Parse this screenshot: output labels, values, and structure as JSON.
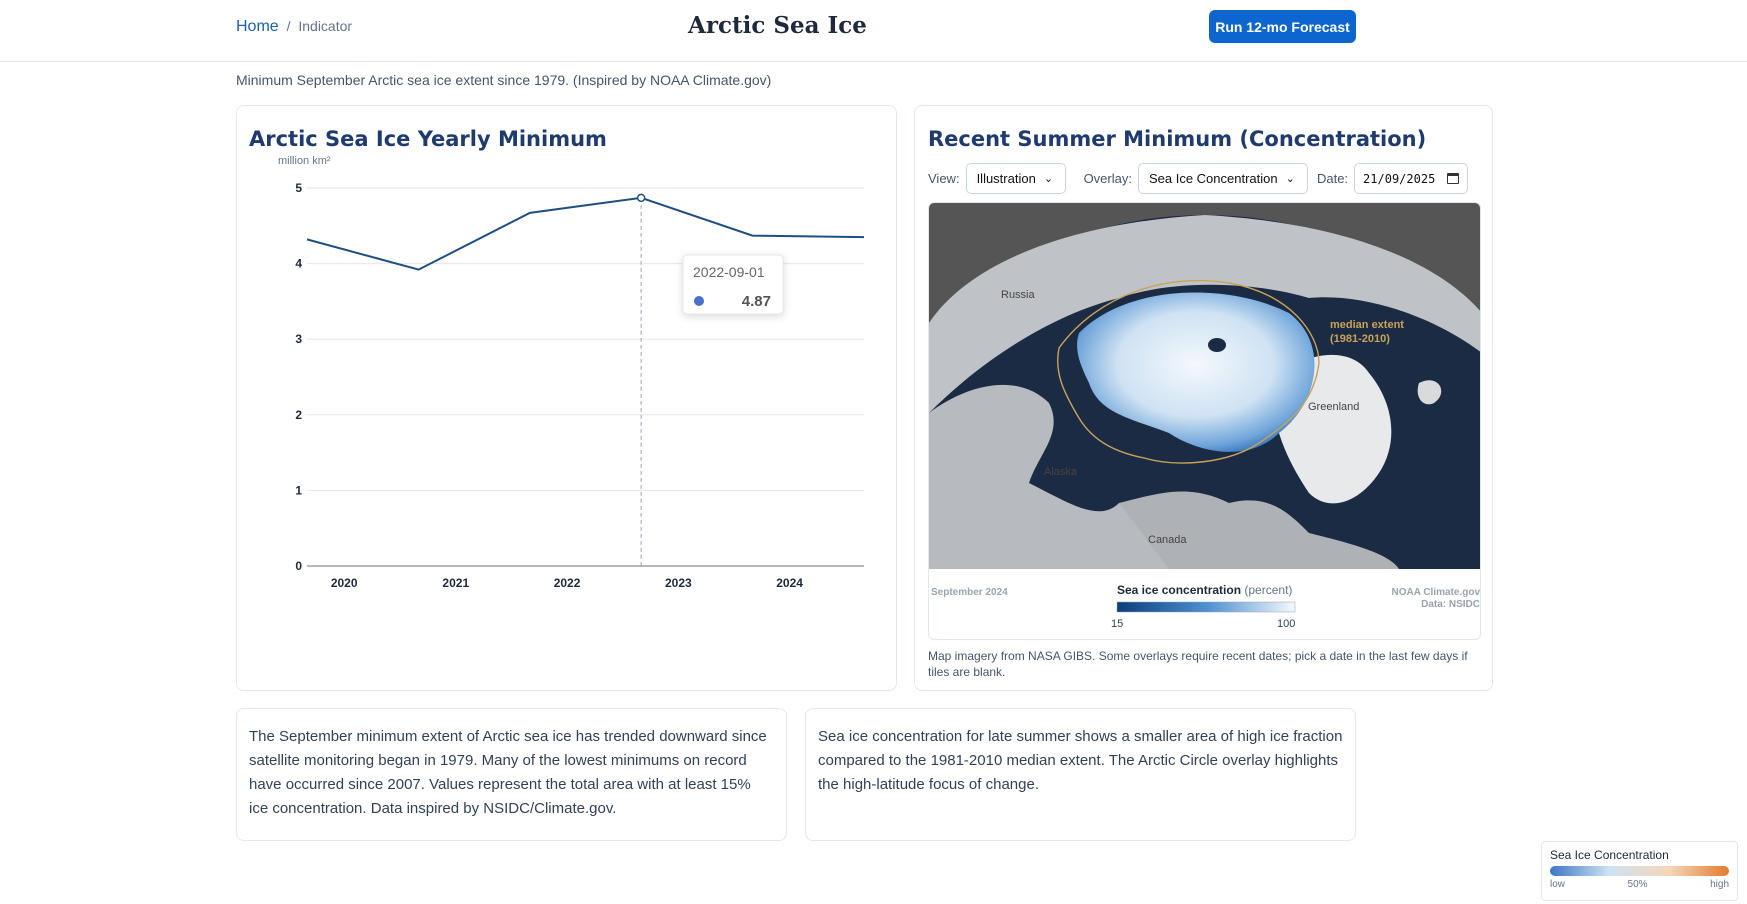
{
  "breadcrumb": {
    "home": "Home",
    "separator": "/",
    "current": "Indicator"
  },
  "header": {
    "title": "Arctic Sea Ice",
    "forecast_button": "Run 12-mo Forecast"
  },
  "subtitle": "Minimum September Arctic sea ice extent since 1979. (Inspired by NOAA Climate.gov)",
  "chart_card": {
    "title": "Arctic Sea Ice Yearly Minimum",
    "tooltip": {
      "date": "2022-09-01",
      "value": "4.87",
      "marker_color": "#4a6fc6"
    }
  },
  "chart_data": {
    "type": "line",
    "title": "Arctic Sea Ice Yearly Minimum",
    "ylabel": "million km²",
    "xlabel": "",
    "x": [
      "2019-09-01",
      "2020-09-01",
      "2021-09-01",
      "2022-09-01",
      "2023-09-01",
      "2024-09-01"
    ],
    "x_ticks": [
      "2020",
      "2021",
      "2022",
      "2023",
      "2024"
    ],
    "series": [
      {
        "values": [
          4.32,
          3.92,
          4.67,
          4.87,
          4.37,
          4.35
        ],
        "color": "#1f4e82"
      }
    ],
    "ylim": [
      0,
      5
    ],
    "y_ticks": [
      "0",
      "1",
      "2",
      "3",
      "4",
      "5"
    ],
    "grid": true
  },
  "map_card": {
    "title": "Recent Summer Minimum (Concentration)",
    "view_label": "View:",
    "view_value": "Illustration",
    "overlay_label": "Overlay:",
    "overlay_value": "Sea Ice Concentration",
    "date_label": "Date:",
    "date_value": "21/09/2025",
    "map": {
      "label_russia": "Russia",
      "label_greenland": "Greenland",
      "label_alaska": "Alaska",
      "label_canada": "Canada",
      "median_extent_line1": "median extent",
      "median_extent_line2": "(1981-2010)",
      "footer_left": "September 2024",
      "footer_title_bold": "Sea ice concentration",
      "footer_title_rest": " (percent)",
      "scale_min": "15",
      "scale_max": "100",
      "credit_line1": "NOAA Climate.gov",
      "credit_line2": "Data: NSIDC"
    },
    "note": "Map imagery from NASA GIBS. Some overlays require recent dates; pick a date in the last few days if tiles are blank."
  },
  "descriptions": {
    "left": "The September minimum extent of Arctic sea ice has trended downward since satellite monitoring began in 1979. Many of the lowest minimums on record have occurred since 2007. Values represent the total area with at least 15% ice concentration. Data inspired by NSIDC/Climate.gov.",
    "right": "Sea ice concentration for late summer shows a smaller area of high ice fraction compared to the 1981-2010 median extent. The Arctic Circle overlay highlights the high-latitude focus of change."
  },
  "legend": {
    "title": "Sea Ice Concentration",
    "low": "low",
    "mid": "50%",
    "high": "high"
  }
}
